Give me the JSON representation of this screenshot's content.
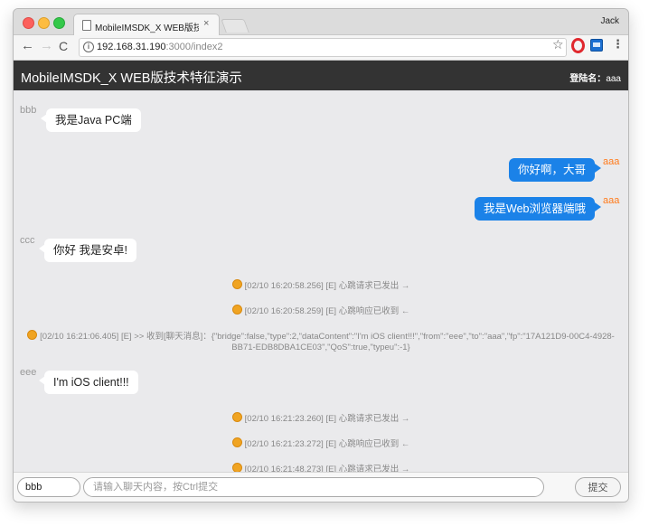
{
  "browser": {
    "tab_title": "MobileIMSDK_X WEB版技术特征",
    "tab_close": "×",
    "profile_name": "Jack",
    "url_host": "192.168.31.190",
    "url_path": ":3000/index2",
    "icons": {
      "back": "←",
      "forward": "→",
      "reload": "C",
      "info": "i",
      "star": "☆",
      "menu": "⋮",
      "close": "×"
    },
    "colors": {
      "traffic_red": "#fc605c",
      "traffic_yellow": "#fdbc40",
      "traffic_green": "#34c84a"
    }
  },
  "app": {
    "title": "MobileIMSDK_X WEB版技术特征演示",
    "login_label": "登陆名：",
    "login_user": "aaa",
    "header_color": "#333333"
  },
  "messages": [
    {
      "type": "incoming",
      "sender": "bbb",
      "text": "我是Java PC端"
    },
    {
      "type": "outgoing",
      "sender": "aaa",
      "text": "你好啊，大哥"
    },
    {
      "type": "outgoing",
      "sender": "aaa",
      "text": "我是Web浏览器端哦"
    },
    {
      "type": "incoming",
      "sender": "ccc",
      "text": "你好 我是安卓!"
    },
    {
      "type": "system",
      "text": "[02/10 16:20:58.256] [E] 心跳请求已发出 →"
    },
    {
      "type": "system",
      "text": "[02/10 16:20:58.259] [E] 心跳响应已收到 ←"
    },
    {
      "type": "system",
      "text": "[02/10 16:21:06.405] [E] >> 收到[聊天消息]：{\"bridge\":false,\"type\":2,\"dataContent\":\"I'm iOS client!!!\",\"from\":\"eee\",\"to\":\"aaa\",\"fp\":\"17A121D9-00C4-4928-BB71-EDB8DBA1CE03\",\"QoS\":true,\"typeu\":-1}"
    },
    {
      "type": "incoming",
      "sender": "eee",
      "text": "I'm iOS client!!!"
    },
    {
      "type": "system",
      "text": "[02/10 16:21:23.260] [E] 心跳请求已发出 →"
    },
    {
      "type": "system",
      "text": "[02/10 16:21:23.272] [E] 心跳响应已收到 ←"
    },
    {
      "type": "system",
      "text": "[02/10 16:21:48.273] [E] 心跳请求已发出 →"
    }
  ],
  "colors": {
    "outgoing_bubble": "#1b82e8",
    "outgoing_sender": "#ff7a1a",
    "system_emoji": "#f0a422"
  },
  "input": {
    "to_value": "bbb",
    "message_placeholder": "请输入聊天内容，按Ctrl提交",
    "send_label": "提交"
  }
}
